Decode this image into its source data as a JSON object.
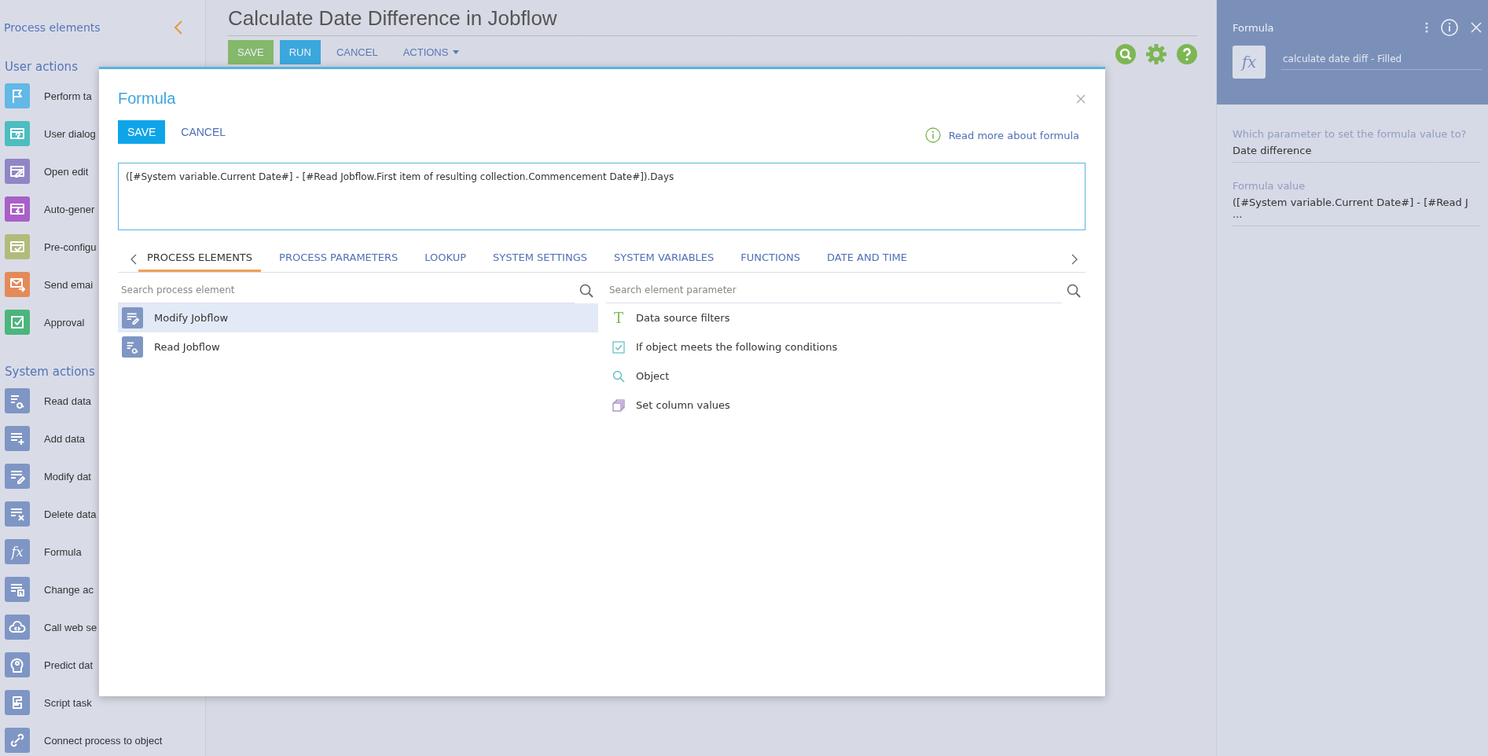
{
  "sidebar": {
    "title": "Process elements",
    "groups": [
      {
        "title": "User actions",
        "items": [
          {
            "label": "Perform ta",
            "kind": "flag",
            "color": "#62b8e6"
          },
          {
            "label": "User dialog",
            "kind": "dialog",
            "color": "#4dbdc0"
          },
          {
            "label": "Open edit",
            "kind": "edit",
            "color": "#9086c6"
          },
          {
            "label": "Auto-gener",
            "kind": "bolt",
            "color": "#a95fc8"
          },
          {
            "label": "Pre-configu",
            "kind": "check",
            "color": "#b2bb7b"
          },
          {
            "label": "Send emai",
            "kind": "mail",
            "color": "#e48a5a"
          },
          {
            "label": "Approval",
            "kind": "approval",
            "color": "#4cb57c"
          }
        ]
      },
      {
        "title": "System actions",
        "items": [
          {
            "label": "Read data",
            "kind": "read",
            "color": "#7f96c4"
          },
          {
            "label": "Add data",
            "kind": "add",
            "color": "#7f96c4"
          },
          {
            "label": "Modify dat",
            "kind": "modify",
            "color": "#7f96c4"
          },
          {
            "label": "Delete data",
            "kind": "delete",
            "color": "#7f96c4"
          },
          {
            "label": "Formula",
            "kind": "formula",
            "glyph": "fx",
            "color": "#7f96c4"
          },
          {
            "label": "Change ac",
            "kind": "change",
            "color": "#7f96c4"
          },
          {
            "label": "Call web se",
            "kind": "cloud",
            "color": "#7f96c4"
          },
          {
            "label": "Predict dat",
            "kind": "head",
            "color": "#7f96c4"
          },
          {
            "label": "Script task",
            "kind": "script",
            "color": "#7f96c4"
          },
          {
            "label": "Connect process to object",
            "kind": "link",
            "color": "#7f96c4"
          }
        ]
      }
    ]
  },
  "main": {
    "title": "Calculate Date Difference in Jobflow",
    "toolbar": [
      {
        "label": "SAVE",
        "kind": "success"
      },
      {
        "label": "RUN",
        "kind": "primary"
      },
      {
        "label": "CANCEL",
        "kind": "link"
      },
      {
        "label": "ACTIONS",
        "kind": "dropdown"
      }
    ]
  },
  "modal": {
    "title": "Formula",
    "buttons": [
      {
        "label": "SAVE",
        "kind": "primary"
      },
      {
        "label": "CANCEL",
        "kind": "link"
      }
    ],
    "help_link": "Read more about formula",
    "formula": "([#System variable.Current Date#] - [#Read Jobflow.First item of resulting collection.Commencement Date#]).Days",
    "tabs": [
      {
        "label": "PROCESS ELEMENTS",
        "selected": true
      },
      {
        "label": "PROCESS PARAMETERS",
        "selected": false
      },
      {
        "label": "LOOKUP",
        "selected": false
      },
      {
        "label": "SYSTEM SETTINGS",
        "selected": false
      },
      {
        "label": "SYSTEM VARIABLES",
        "selected": false
      },
      {
        "label": "FUNCTIONS",
        "selected": false
      },
      {
        "label": "DATE AND TIME",
        "selected": false
      }
    ],
    "element_search": {
      "placeholder": "Search process element"
    },
    "elements": [
      {
        "label": "Modify Jobflow",
        "kind": "modify",
        "selected": true
      },
      {
        "label": "Read Jobflow",
        "kind": "read",
        "selected": false
      }
    ],
    "parameter_search": {
      "placeholder": "Search element parameter"
    },
    "parameters": [
      {
        "label": "Data source filters",
        "kind": "text",
        "glyph": "T"
      },
      {
        "label": "If object meets the following conditions",
        "kind": "checkbox"
      },
      {
        "label": "Object",
        "kind": "lookup"
      },
      {
        "label": "Set column values",
        "kind": "columns"
      }
    ]
  },
  "right_panel": {
    "title": "Formula",
    "glyph": "fx",
    "name": "calculate date diff - Filled",
    "fields": [
      {
        "label": "Which parameter to set the formula value to?",
        "value": "Date difference"
      },
      {
        "label": "Formula value",
        "value": "([#System variable.Current Date#] - [#Read J ..."
      }
    ]
  }
}
